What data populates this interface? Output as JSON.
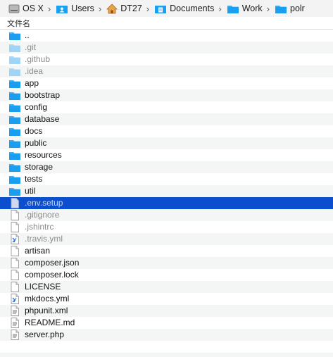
{
  "breadcrumb": [
    {
      "label": "OS X",
      "icon": "hard-drive-icon"
    },
    {
      "label": "Users",
      "icon": "users-folder-icon"
    },
    {
      "label": "DT27",
      "icon": "home-icon"
    },
    {
      "label": "Documents",
      "icon": "documents-folder-icon"
    },
    {
      "label": "Work",
      "icon": "folder-icon"
    },
    {
      "label": "polr",
      "icon": "folder-icon"
    }
  ],
  "column_header": "文件名",
  "files": [
    {
      "name": "..",
      "kind": "folder",
      "style": "normal"
    },
    {
      "name": ".git",
      "kind": "folder",
      "style": "hidden"
    },
    {
      "name": ".github",
      "kind": "folder",
      "style": "hidden"
    },
    {
      "name": ".idea",
      "kind": "folder",
      "style": "hidden"
    },
    {
      "name": "app",
      "kind": "folder",
      "style": "normal"
    },
    {
      "name": "bootstrap",
      "kind": "folder",
      "style": "normal"
    },
    {
      "name": "config",
      "kind": "folder",
      "style": "normal"
    },
    {
      "name": "database",
      "kind": "folder",
      "style": "normal"
    },
    {
      "name": "docs",
      "kind": "folder",
      "style": "normal"
    },
    {
      "name": "public",
      "kind": "folder",
      "style": "normal"
    },
    {
      "name": "resources",
      "kind": "folder",
      "style": "normal"
    },
    {
      "name": "storage",
      "kind": "folder",
      "style": "normal"
    },
    {
      "name": "tests",
      "kind": "folder",
      "style": "normal"
    },
    {
      "name": "util",
      "kind": "folder",
      "style": "normal"
    },
    {
      "name": ".env.setup",
      "kind": "file",
      "style": "selected"
    },
    {
      "name": ".gitignore",
      "kind": "file",
      "style": "hidden"
    },
    {
      "name": ".jshintrc",
      "kind": "file",
      "style": "hidden"
    },
    {
      "name": ".travis.yml",
      "kind": "code-file",
      "style": "hidden"
    },
    {
      "name": "artisan",
      "kind": "file",
      "style": "normal"
    },
    {
      "name": "composer.json",
      "kind": "file",
      "style": "normal"
    },
    {
      "name": "composer.lock",
      "kind": "file",
      "style": "normal"
    },
    {
      "name": "LICENSE",
      "kind": "file",
      "style": "normal"
    },
    {
      "name": "mkdocs.yml",
      "kind": "code-file",
      "style": "normal"
    },
    {
      "name": "phpunit.xml",
      "kind": "text-file",
      "style": "normal"
    },
    {
      "name": "README.md",
      "kind": "text-file",
      "style": "normal"
    },
    {
      "name": "server.php",
      "kind": "text-file",
      "style": "normal"
    }
  ],
  "colors": {
    "selection": "#0b4fcf",
    "folder": "#1a9ff0",
    "hidden_folder": "#9fd4f7",
    "hidden_text": "#8d8d8d"
  }
}
